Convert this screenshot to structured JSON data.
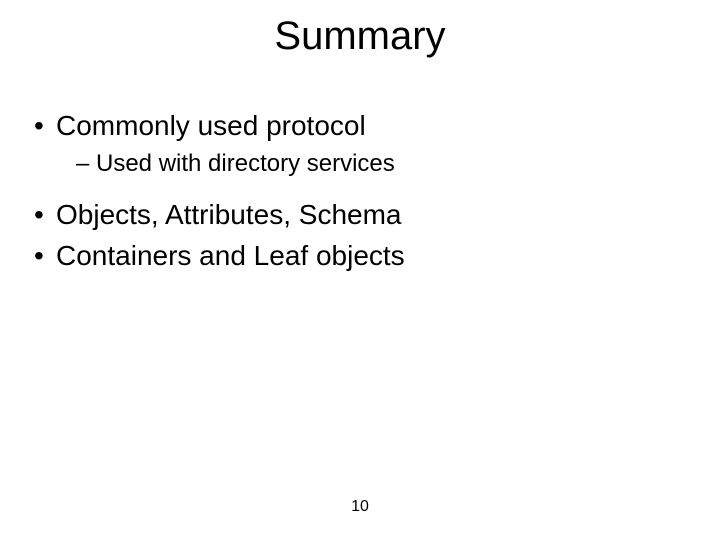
{
  "title": "Summary",
  "bullets": {
    "b1": "Commonly used protocol",
    "b1_sub1": "Used with directory services",
    "b2": "Objects, Attributes, Schema",
    "b3": "Containers and Leaf objects"
  },
  "page_number": "10"
}
